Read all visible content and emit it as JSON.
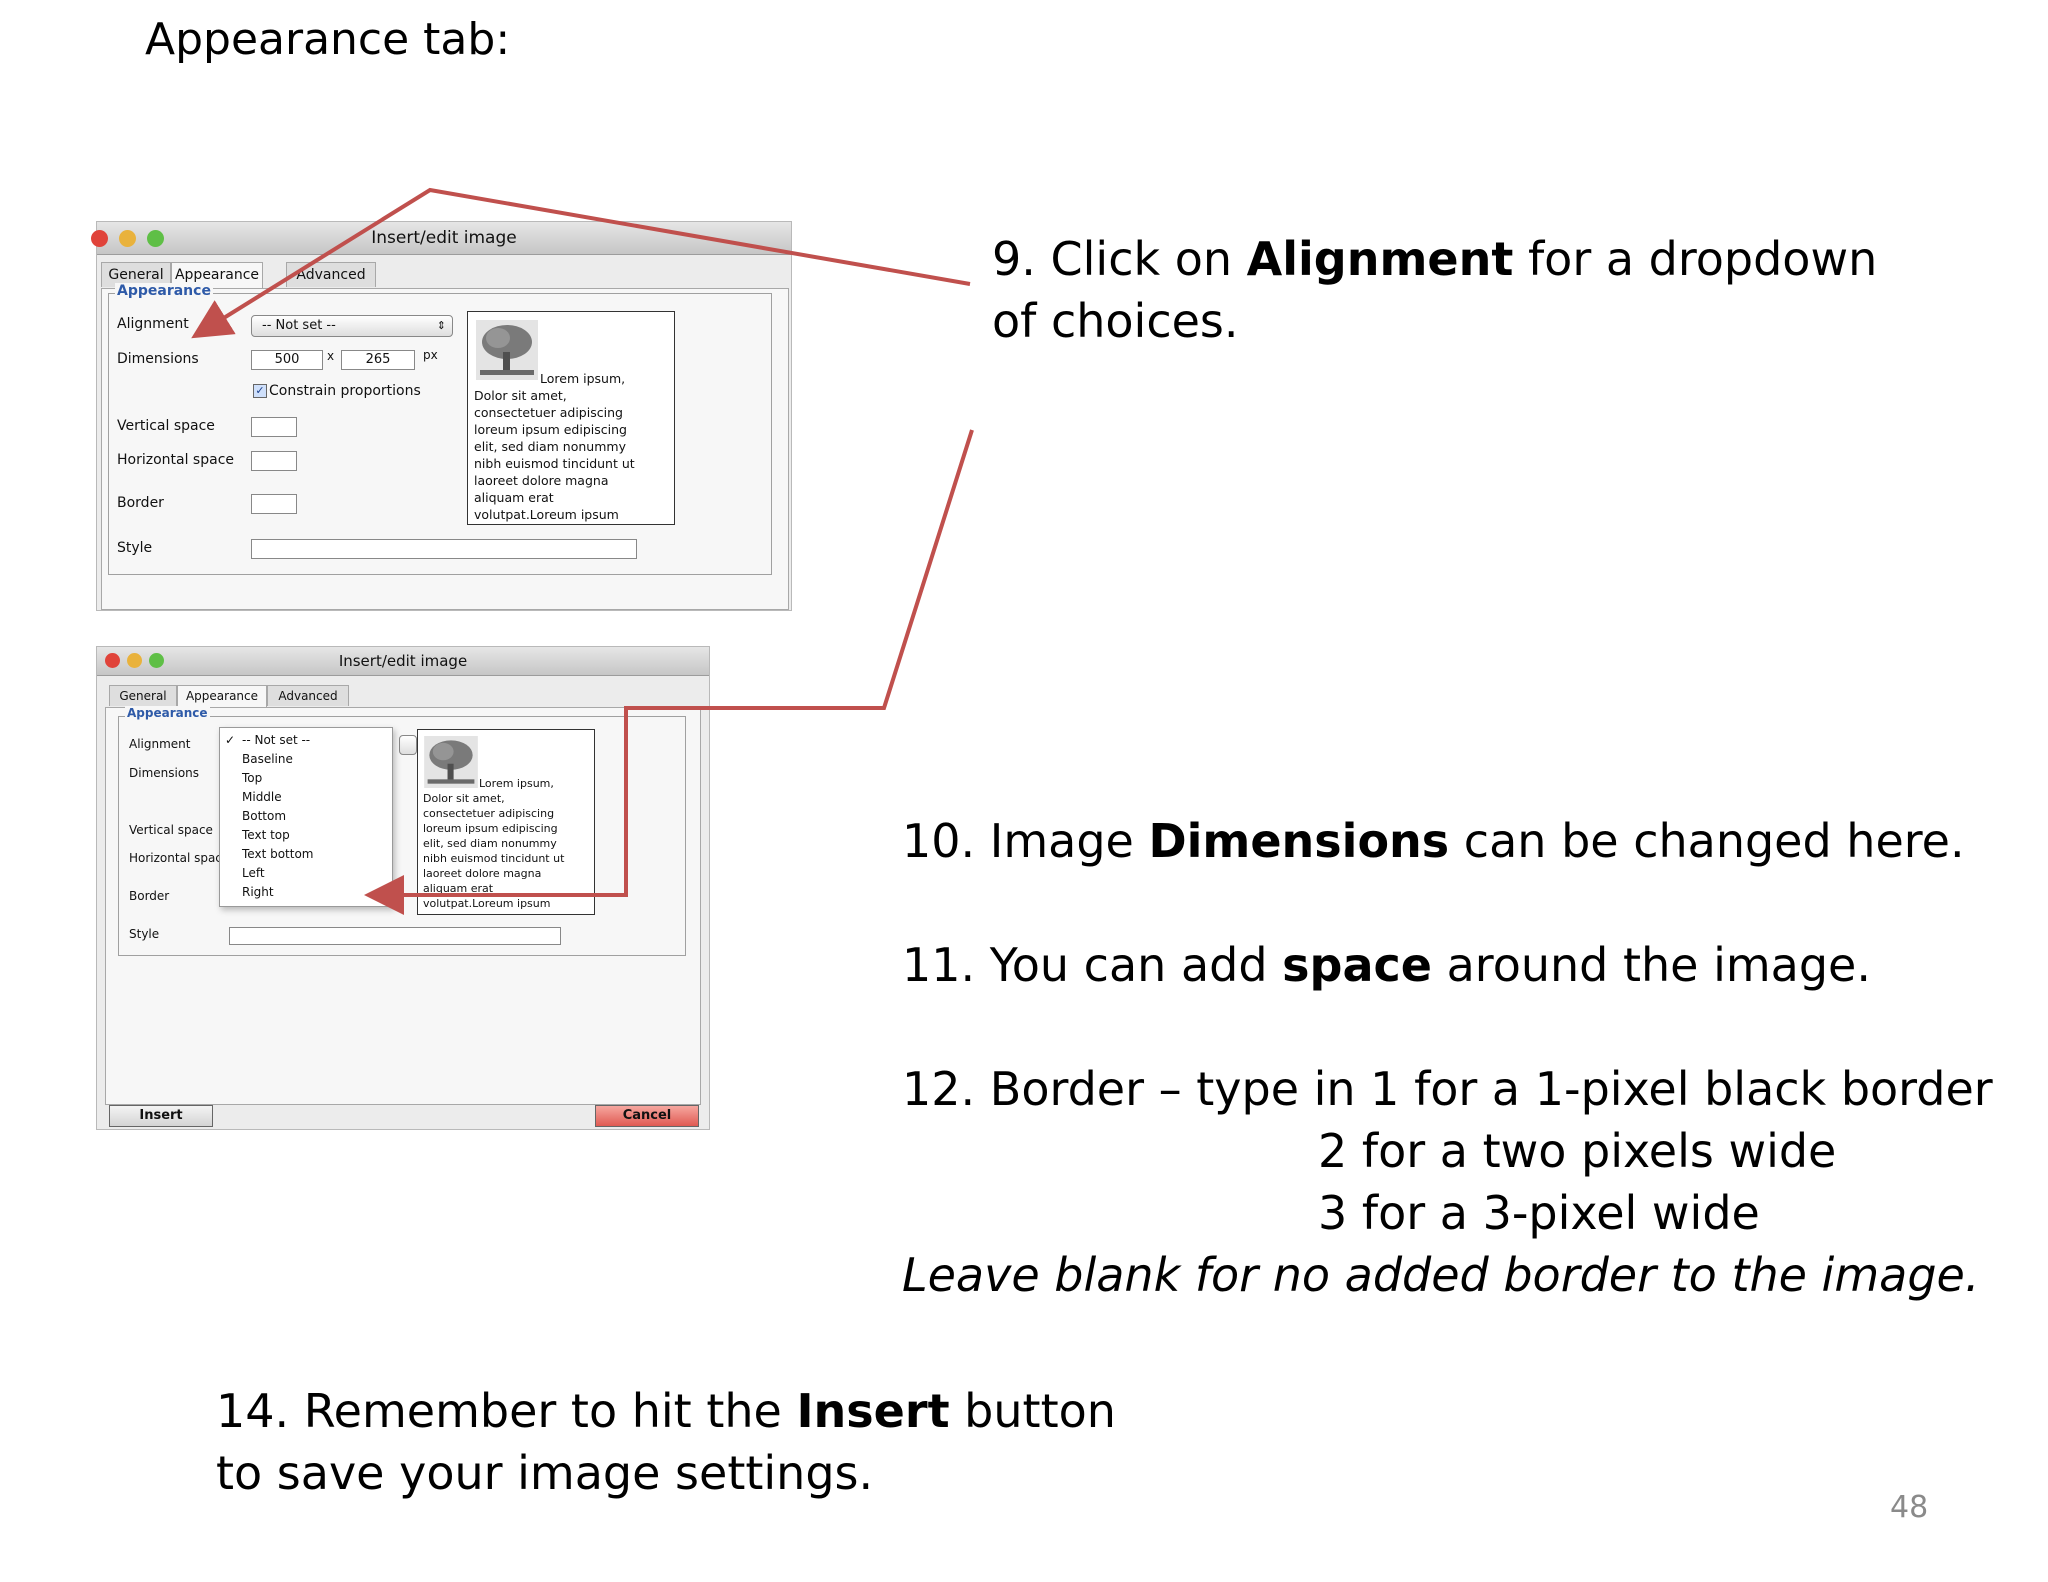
{
  "slide": {
    "title": "Appearance tab:",
    "page_number": "48"
  },
  "dialog1": {
    "window_title": "Insert/edit image",
    "tabs": [
      "General",
      "Appearance",
      "Advanced"
    ],
    "legend": "Appearance",
    "labels": {
      "alignment": "Alignment",
      "dimensions": "Dimensions",
      "constrain": "Constrain proportions",
      "vertical_space": "Vertical space",
      "horizontal_space": "Horizontal space",
      "border": "Border",
      "style": "Style"
    },
    "alignment_value": "-- Not set --",
    "width": "500",
    "height": "265",
    "times": "x",
    "unit": "px",
    "preview_lines": [
      "Lorem ipsum,",
      "Dolor sit amet,",
      "consectetuer adipiscing",
      "loreum ipsum edipiscing",
      "elit, sed diam nonummy",
      "nibh euismod tincidunt ut",
      "laoreet dolore magna",
      "aliquam erat",
      "volutpat.Loreum ipsum"
    ]
  },
  "dialog2": {
    "window_title": "Insert/edit image",
    "tabs": [
      "General",
      "Appearance",
      "Advanced"
    ],
    "legend": "Appearance",
    "labels": {
      "alignment": "Alignment",
      "dimensions": "Dimensions",
      "vertical_space": "Vertical space",
      "horizontal_space": "Horizontal space",
      "border": "Border",
      "style": "Style"
    },
    "menu_check": "✓",
    "menu_items": [
      "-- Not set --",
      "Baseline",
      "Top",
      "Middle",
      "Bottom",
      "Text top",
      "Text bottom",
      "Left",
      "Right"
    ],
    "preview_lines": [
      "Lorem ipsum,",
      "Dolor sit amet,",
      "consectetuer adipiscing",
      "loreum ipsum edipiscing",
      "elit, sed diam nonummy",
      "nibh euismod tincidunt ut",
      "laoreet dolore magna",
      "aliquam erat",
      "volutpat.Loreum ipsum"
    ],
    "insert_label": "Insert",
    "cancel_label": "Cancel"
  },
  "notes": {
    "n9_pre": "9. Click on ",
    "n9_bold": "Alignment",
    "n9_post": " for a dropdown",
    "n9_line2": "of choices.",
    "n10_pre": "10. Image ",
    "n10_bold": "Dimensions",
    "n10_post": " can be changed here.",
    "n11_pre": "11. You can add ",
    "n11_bold": "space",
    "n11_post": " around the image.",
    "n12_line1": "12. Border – type in 1 for a 1-pixel black border",
    "n12_line2": "2 for a two pixels wide",
    "n12_line3": "3 for a 3-pixel wide",
    "n12_italic": "Leave blank for no added border to the image.",
    "n14_pre": "14. Remember to hit the ",
    "n14_bold": "Insert",
    "n14_post": " button",
    "n14_line2": "to save your image settings."
  },
  "colors": {
    "arrow": "#c0504d",
    "legend_blue": "#2e5aa8",
    "cancel_red": "#e05a52"
  }
}
